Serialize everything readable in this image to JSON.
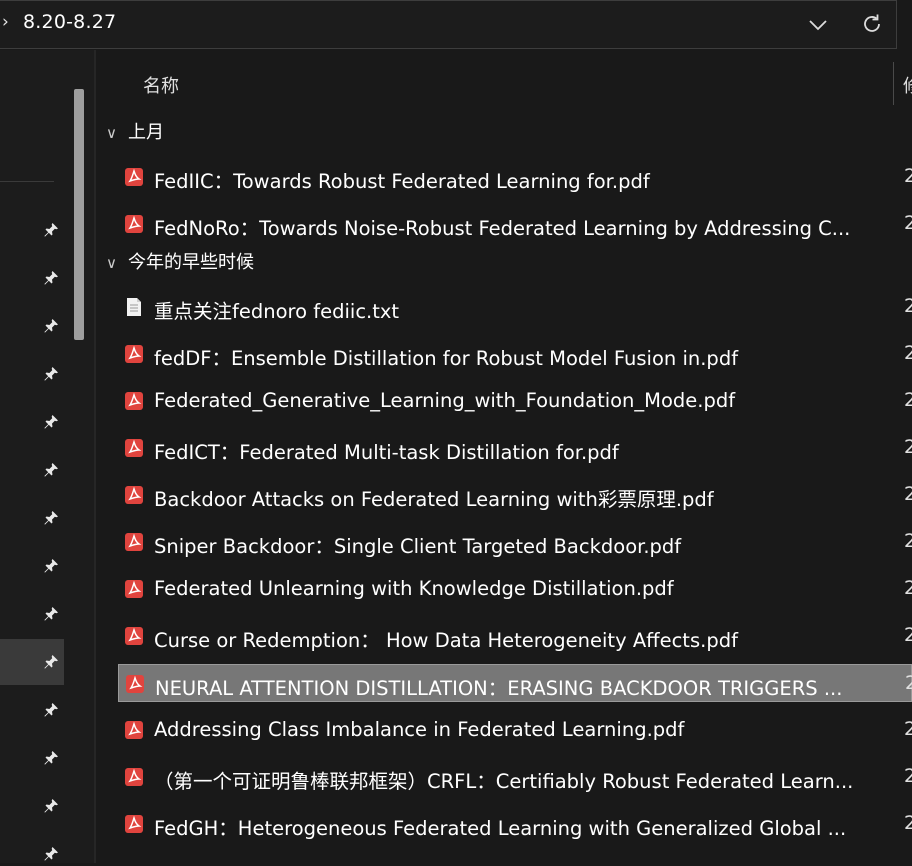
{
  "address": {
    "path": "8.20-8.27",
    "chevron": "chevron-right-icon",
    "dropdown_icon": "chevron-down-icon",
    "refresh_icon": "refresh-icon"
  },
  "header": {
    "name_col": "名称",
    "next_col": "修"
  },
  "colors": {
    "background": "#191919",
    "selection": "#777777",
    "pdf_red": "#e0443e"
  },
  "groups": [
    {
      "label": "上月",
      "files": [
        {
          "name": "FedIIC：Towards Robust Federated Learning for.pdf",
          "type": "pdf",
          "date": "2"
        },
        {
          "name": "FedNoRo：Towards Noise-Robust Federated Learning by Addressing C...",
          "type": "pdf",
          "date": "2"
        }
      ]
    },
    {
      "label": "今年的早些时候",
      "files": [
        {
          "name": "重点关注fednoro fediic.txt",
          "type": "txt",
          "date": "2"
        },
        {
          "name": "fedDF：Ensemble Distillation for Robust Model Fusion in.pdf",
          "type": "pdf",
          "date": "2"
        },
        {
          "name": "Federated_Generative_Learning_with_Foundation_Mode.pdf",
          "type": "pdf",
          "date": "2"
        },
        {
          "name": "FedICT：Federated Multi-task Distillation for.pdf",
          "type": "pdf",
          "date": "2"
        },
        {
          "name": "Backdoor Attacks on Federated Learning with彩票原理.pdf",
          "type": "pdf",
          "date": "2"
        },
        {
          "name": "Sniper Backdoor：Single Client Targeted Backdoor.pdf",
          "type": "pdf",
          "date": "2"
        },
        {
          "name": "Federated Unlearning with Knowledge Distillation.pdf",
          "type": "pdf",
          "date": "2"
        },
        {
          "name": "Curse or Redemption： How Data Heterogeneity Affects.pdf",
          "type": "pdf",
          "date": "2"
        },
        {
          "name": "NEURAL ATTENTION DISTILLATION：ERASING BACKDOOR TRIGGERS ...",
          "type": "pdf",
          "date": "2",
          "selected": true
        },
        {
          "name": "Addressing Class Imbalance in Federated Learning.pdf",
          "type": "pdf",
          "date": "2"
        },
        {
          "name": "（第一个可证明鲁棒联邦框架）CRFL：Certifiably Robust Federated Learn...",
          "type": "pdf",
          "date": "2"
        },
        {
          "name": "FedGH：Heterogeneous Federated Learning with Generalized Global ...",
          "type": "pdf",
          "date": "2"
        }
      ]
    }
  ],
  "nav": {
    "pin_icon": "pin-icon",
    "pin_count": 14
  }
}
